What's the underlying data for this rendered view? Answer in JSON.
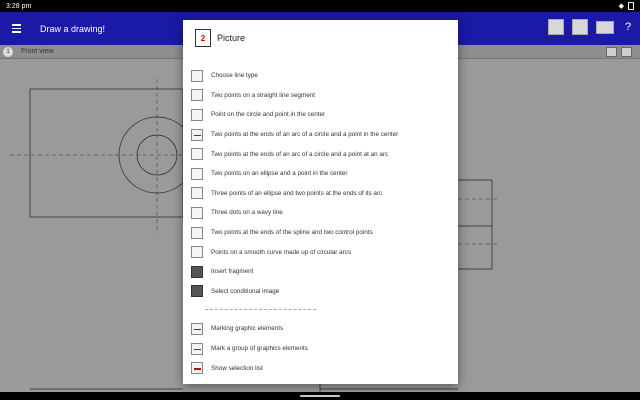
{
  "status_bar": {
    "time": "3:28 pm",
    "wifi_icon": "wifi-icon",
    "battery_icon": "battery-icon"
  },
  "app_bar": {
    "title": "Draw a drawing!",
    "help_label": "?"
  },
  "view": {
    "number": "1",
    "title": "Front view"
  },
  "dialog": {
    "logo_text": "2",
    "title": "Picture",
    "items": [
      {
        "label": "Choose line type",
        "icon": "grid-icon"
      },
      {
        "label": "Two points on a straight line segment",
        "icon": "line-segment-icon"
      },
      {
        "label": "Point on the circle and point in the center",
        "icon": "circle-icon"
      },
      {
        "label": "Two points at the ends of an arc of a circle and a point in the center",
        "icon": "arc-center-icon"
      },
      {
        "label": "Two points at the ends of an arc of a circle and a point at an arc",
        "icon": "arc-point-icon"
      },
      {
        "label": "Two points on an ellipse and a point in the center",
        "icon": "ellipse-icon"
      },
      {
        "label": "Three points of an ellipse and two points at the ends of its arc",
        "icon": "ellipse-arc-icon"
      },
      {
        "label": "Three dots on a wavy line",
        "icon": "wavy-line-icon"
      },
      {
        "label": "Two points at the ends of the spline and two control points",
        "icon": "spline-icon"
      },
      {
        "label": "Points on a smooth curve made up of circular arcs",
        "icon": "smooth-curve-icon"
      },
      {
        "label": "Insert fragment",
        "icon": "fragment-icon"
      },
      {
        "label": "Select conditional image",
        "icon": "conditional-image-icon"
      }
    ],
    "items2": [
      {
        "label": "Marking graphic elements",
        "icon": "mark-elements-icon"
      },
      {
        "label": "Mark a group of graphics elements",
        "icon": "mark-group-icon"
      },
      {
        "label": "Show selection list",
        "icon": "selection-list-icon"
      }
    ]
  }
}
